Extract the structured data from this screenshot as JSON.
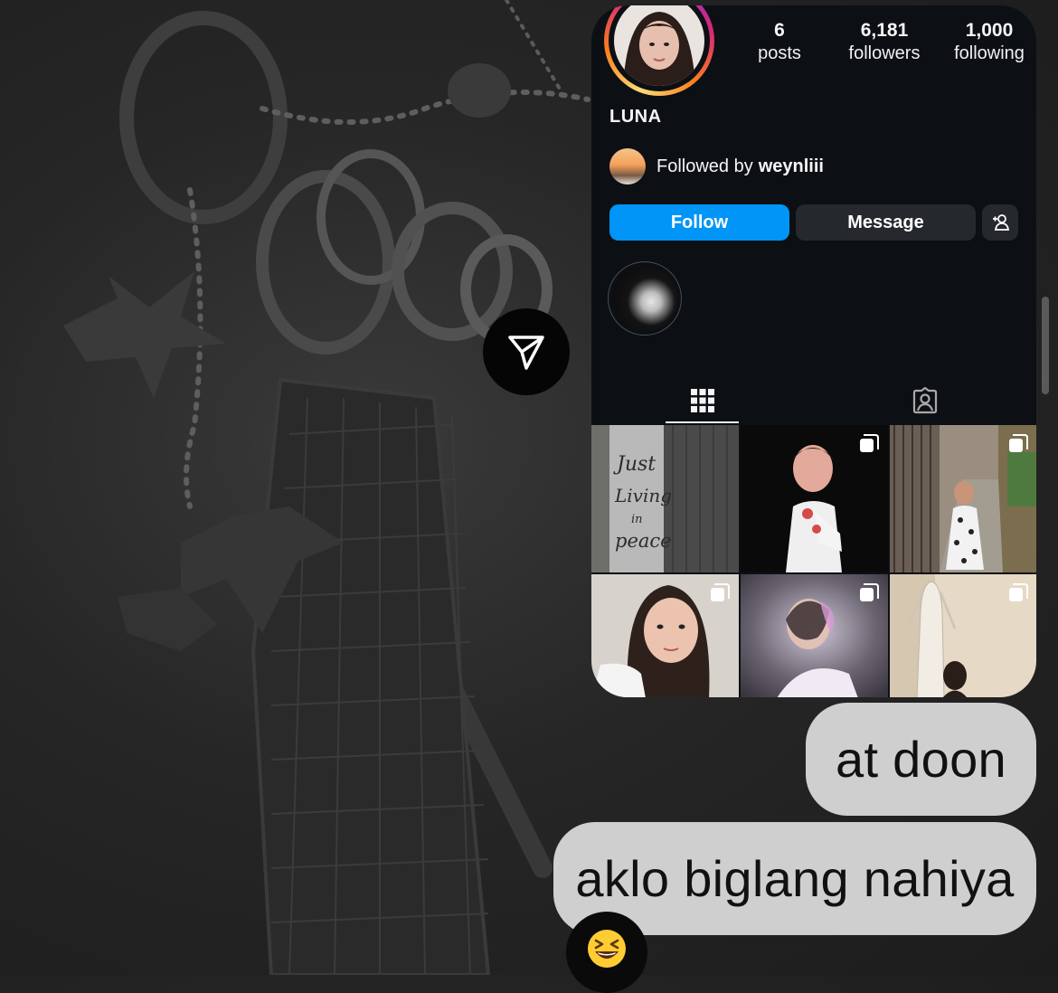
{
  "profile": {
    "username": "LUNA",
    "stats": {
      "posts": {
        "value": "6",
        "label": "posts"
      },
      "followers": {
        "value": "6,181",
        "label": "followers"
      },
      "following": {
        "value": "1,000",
        "label": "following"
      }
    },
    "followed_by": {
      "prefix": "Followed by",
      "user": "weynliii"
    },
    "buttons": {
      "follow": "Follow",
      "message": "Message"
    },
    "tabs": [
      "grid-tab",
      "tagged-tab"
    ],
    "grid_posts": [
      {
        "type": "single",
        "caption_art": "Just Living in peace"
      },
      {
        "type": "multi"
      },
      {
        "type": "multi"
      },
      {
        "type": "multi"
      },
      {
        "type": "multi"
      },
      {
        "type": "multi"
      }
    ]
  },
  "messages": [
    {
      "text": "at doon"
    },
    {
      "text": "aklo biglang nahiya"
    }
  ],
  "reaction": {
    "emoji": "😆"
  },
  "colors": {
    "card_bg": "#0c1014",
    "follow_blue": "#0095f6",
    "secondary_button": "#25292e",
    "bubble_bg": "#cfcfcf"
  }
}
